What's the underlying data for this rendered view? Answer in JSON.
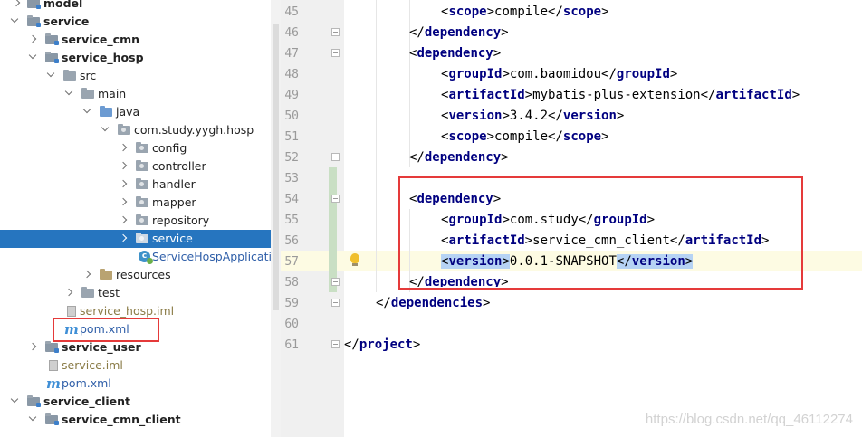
{
  "tree": {
    "items": [
      {
        "label": "model"
      },
      {
        "label": "service"
      },
      {
        "label": "service_cmn"
      },
      {
        "label": "service_hosp"
      },
      {
        "label": "src"
      },
      {
        "label": "main"
      },
      {
        "label": "java"
      },
      {
        "label": "com.study.yygh.hosp"
      },
      {
        "label": "config"
      },
      {
        "label": "controller"
      },
      {
        "label": "handler"
      },
      {
        "label": "mapper"
      },
      {
        "label": "repository"
      },
      {
        "label": "service"
      },
      {
        "label": "ServiceHospApplication"
      },
      {
        "label": "resources"
      },
      {
        "label": "test"
      },
      {
        "label": "service_hosp.iml"
      },
      {
        "label": "pom.xml"
      },
      {
        "label": "service_user"
      },
      {
        "label": "service.iml"
      },
      {
        "label": "pom.xml"
      },
      {
        "label": "service_client"
      },
      {
        "label": "service_cmn_client"
      }
    ]
  },
  "editor": {
    "line_numbers": [
      "45",
      "46",
      "47",
      "48",
      "49",
      "50",
      "51",
      "52",
      "53",
      "54",
      "55",
      "56",
      "57",
      "58",
      "59",
      "60",
      "61"
    ],
    "lines": {
      "l45": {
        "open": "scope",
        "text": "compile",
        "close": "scope"
      },
      "l46": {
        "close": "dependency"
      },
      "l47": {
        "open": "dependency"
      },
      "l48": {
        "open": "groupId",
        "text": "com.baomidou",
        "close": "groupId"
      },
      "l49": {
        "open": "artifactId",
        "text": "mybatis-plus-extension",
        "close": "artifactId"
      },
      "l50": {
        "open": "version",
        "text": "3.4.2",
        "close": "version"
      },
      "l51": {
        "open": "scope",
        "text": "compile",
        "close": "scope"
      },
      "l52": {
        "close": "dependency"
      },
      "l54": {
        "open": "dependency"
      },
      "l55": {
        "open": "groupId",
        "text": "com.study",
        "close": "groupId"
      },
      "l56": {
        "open": "artifactId",
        "text": "service_cmn_client",
        "close": "artifactId"
      },
      "l57": {
        "open": "version",
        "text": "0.0.1-SNAPSHOT",
        "close": "version"
      },
      "l58": {
        "close": "dependency"
      },
      "l59": {
        "close": "dependencies"
      },
      "l61": {
        "close": "project"
      }
    }
  },
  "watermark": "https://blog.csdn.net/qq_46112274",
  "colors": {
    "selection": "#2675bf",
    "highlight_box": "#e53a3a",
    "xml_tag": "#000080"
  }
}
